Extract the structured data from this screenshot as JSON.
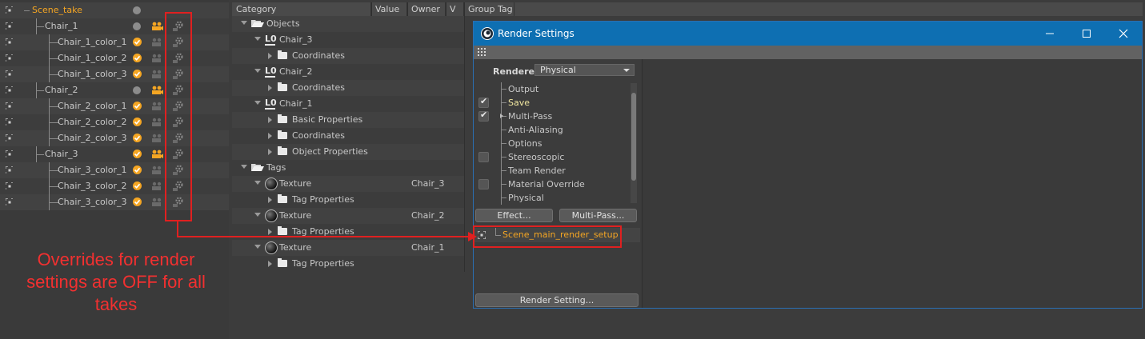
{
  "takes": {
    "items": [
      {
        "label": "Scene_take",
        "level": 0,
        "indicator": "dot",
        "camera": false,
        "highlight": true
      },
      {
        "label": "Chair_1",
        "level": 1,
        "indicator": "dot",
        "camera": true,
        "highlight": false
      },
      {
        "label": "Chair_1_color_1",
        "level": 2,
        "indicator": "check",
        "camera": false,
        "highlight": false
      },
      {
        "label": "Chair_1_color_2",
        "level": 2,
        "indicator": "check",
        "camera": false,
        "highlight": false
      },
      {
        "label": "Chair_1_color_3",
        "level": 2,
        "indicator": "check",
        "camera": false,
        "highlight": false
      },
      {
        "label": "Chair_2",
        "level": 1,
        "indicator": "dot",
        "camera": true,
        "highlight": false
      },
      {
        "label": "Chair_2_color_1",
        "level": 2,
        "indicator": "check",
        "camera": false,
        "highlight": false
      },
      {
        "label": "Chair_2_color_2",
        "level": 2,
        "indicator": "check",
        "camera": false,
        "highlight": false
      },
      {
        "label": "Chair_2_color_3",
        "level": 2,
        "indicator": "check",
        "camera": false,
        "highlight": false
      },
      {
        "label": "Chair_3",
        "level": 1,
        "indicator": "check",
        "camera": true,
        "highlight": false
      },
      {
        "label": "Chair_3_color_1",
        "level": 2,
        "indicator": "check",
        "camera": false,
        "highlight": false
      },
      {
        "label": "Chair_3_color_2",
        "level": 2,
        "indicator": "check",
        "camera": false,
        "highlight": false
      },
      {
        "label": "Chair_3_color_3",
        "level": 2,
        "indicator": "check",
        "camera": false,
        "highlight": false
      }
    ]
  },
  "overrides": {
    "columns": [
      "Category",
      "Value",
      "Owner",
      "V",
      "Group Tag"
    ],
    "rows": [
      {
        "label": "Objects",
        "level": 0,
        "icon": "folder-open-icon",
        "owner": ""
      },
      {
        "label": "Chair_3",
        "level": 1,
        "icon": "null-object-icon",
        "owner": ""
      },
      {
        "label": "Coordinates",
        "level": 2,
        "icon": "folder-icon",
        "owner": ""
      },
      {
        "label": "Chair_2",
        "level": 1,
        "icon": "null-object-icon",
        "owner": ""
      },
      {
        "label": "Coordinates",
        "level": 2,
        "icon": "folder-icon",
        "owner": ""
      },
      {
        "label": "Chair_1",
        "level": 1,
        "icon": "null-object-icon",
        "owner": ""
      },
      {
        "label": "Basic Properties",
        "level": 2,
        "icon": "folder-icon",
        "owner": ""
      },
      {
        "label": "Coordinates",
        "level": 2,
        "icon": "folder-icon",
        "owner": ""
      },
      {
        "label": "Object Properties",
        "level": 2,
        "icon": "folder-icon",
        "owner": ""
      },
      {
        "label": "Tags",
        "level": 0,
        "icon": "folder-open-icon",
        "owner": ""
      },
      {
        "label": "Texture",
        "level": 1,
        "icon": "texture-tag-icon",
        "owner": "Chair_3"
      },
      {
        "label": "Tag Properties",
        "level": 2,
        "icon": "folder-icon",
        "owner": ""
      },
      {
        "label": "Texture",
        "level": 1,
        "icon": "texture-tag-icon",
        "owner": "Chair_2"
      },
      {
        "label": "Tag Properties",
        "level": 2,
        "icon": "folder-icon",
        "owner": ""
      },
      {
        "label": "Texture",
        "level": 1,
        "icon": "texture-tag-icon",
        "owner": "Chair_1"
      },
      {
        "label": "Tag Properties",
        "level": 2,
        "icon": "folder-icon",
        "owner": ""
      }
    ]
  },
  "render_settings": {
    "title": "Render Settings",
    "renderer_label": "Renderer",
    "renderer_value": "Physical",
    "items": [
      {
        "label": "Output",
        "checkbox": "none",
        "active": false
      },
      {
        "label": "Save",
        "checkbox": "on",
        "active": true
      },
      {
        "label": "Multi-Pass",
        "checkbox": "on",
        "active": false
      },
      {
        "label": "Anti-Aliasing",
        "checkbox": "none",
        "active": false
      },
      {
        "label": "Options",
        "checkbox": "none",
        "active": false
      },
      {
        "label": "Stereoscopic",
        "checkbox": "off",
        "active": false
      },
      {
        "label": "Team Render",
        "checkbox": "none",
        "active": false
      },
      {
        "label": "Material Override",
        "checkbox": "off",
        "active": false
      },
      {
        "label": "Physical",
        "checkbox": "none",
        "active": false
      }
    ],
    "effect_button": "Effect...",
    "multipass_button": "Multi-Pass...",
    "setup_name": "Scene_main_render_setup",
    "render_setting_button": "Render Setting..."
  },
  "annotation": {
    "text": "Overrides for render settings are OFF for all takes"
  },
  "colors": {
    "accent_orange": "#f5a623",
    "title_blue": "#0e6fb2",
    "annotation_red": "#e02020"
  }
}
